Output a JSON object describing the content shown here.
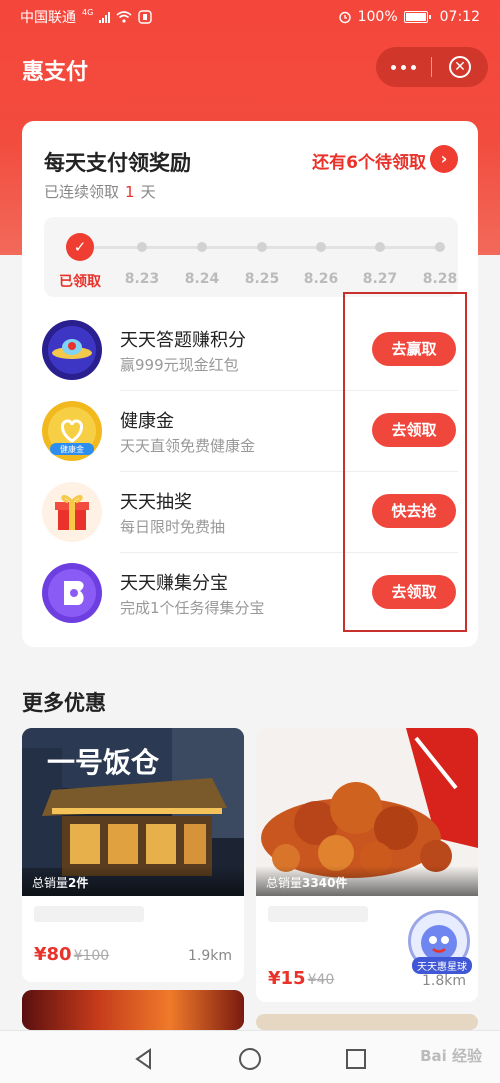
{
  "status_bar": {
    "carrier": "中国联通",
    "network": "4G",
    "battery": "100%",
    "time": "07:12"
  },
  "header": {
    "title": "惠支付",
    "more_icon": "more-dots-icon",
    "close_icon": "close-circle-icon"
  },
  "reward": {
    "title": "每天支付领奖励",
    "pending": "还有6个待领取",
    "streak_prefix": "已连续领取",
    "streak_days": "1",
    "streak_suffix": "天",
    "steps": [
      {
        "label": "已领取",
        "done": true
      },
      {
        "label": "8.23",
        "done": false
      },
      {
        "label": "8.24",
        "done": false
      },
      {
        "label": "8.25",
        "done": false
      },
      {
        "label": "8.26",
        "done": false
      },
      {
        "label": "8.27",
        "done": false
      },
      {
        "label": "8.28",
        "done": false
      }
    ]
  },
  "tasks": [
    {
      "name": "天天答题赚积分",
      "desc": "赢999元现金红包",
      "button": "去赢取",
      "icon": "ufo-quiz-icon"
    },
    {
      "name": "健康金",
      "desc": "天天直领免费健康金",
      "button": "去领取",
      "icon": "health-gold-coin-icon",
      "icon_text": "健康金"
    },
    {
      "name": "天天抽奖",
      "desc": "每日限时免费抽",
      "button": "快去抢",
      "icon": "gift-box-icon"
    },
    {
      "name": "天天赚集分宝",
      "desc": "完成1个任务得集分宝",
      "button": "去领取",
      "icon": "points-treasure-icon"
    }
  ],
  "more_deals": {
    "title": "更多优惠",
    "items": [
      {
        "sales_prefix": "总销量",
        "sales": "2件",
        "price": "¥80",
        "original_price": "¥100",
        "distance": "1.9km",
        "sign_text": "一号饭仓"
      },
      {
        "sales_prefix": "总销量",
        "sales": "3340件",
        "price": "¥15",
        "original_price": "¥40",
        "distance": "1.8km",
        "badge": "天天惠星球"
      }
    ]
  },
  "watermark": "Bai 经验",
  "colors": {
    "brand_red": "#ef3d31",
    "accent_text": "#e8322a",
    "highlight_border": "#c9302c"
  }
}
